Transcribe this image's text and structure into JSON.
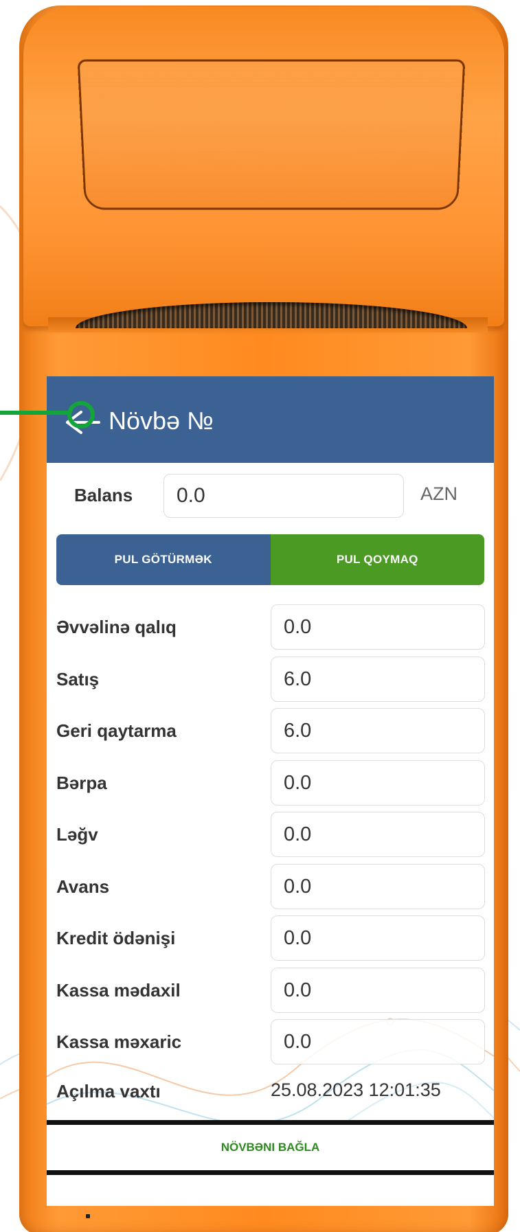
{
  "header": {
    "title": "Növbə №"
  },
  "balance": {
    "label": "Balans",
    "value": "0.0",
    "unit": "AZN"
  },
  "tabs": [
    {
      "label": "PUL GÖTÜRMƏK",
      "color": "#3c6193"
    },
    {
      "label": "PUL QOYMAQ",
      "color": "#4a9a24"
    }
  ],
  "fields": [
    {
      "label": "Əvvəlinə qalıq",
      "value": "0.0"
    },
    {
      "label": "Satış",
      "value": "6.0"
    },
    {
      "label": "Geri qaytarma",
      "value": "6.0"
    },
    {
      "label": "Bərpa",
      "value": "0.0"
    },
    {
      "label": "Ləğv",
      "value": "0.0"
    },
    {
      "label": "Avans",
      "value": "0.0"
    },
    {
      "label": "Kredit ödənişi",
      "value": "0.0"
    },
    {
      "label": "Kassa mədaxil",
      "value": "0.0"
    },
    {
      "label": "Kassa məxaric",
      "value": "0.0"
    }
  ],
  "opened": {
    "label": "Açılma vaxtı",
    "value": "25.08.2023 12:01:35"
  },
  "close_button": {
    "label": "NÖVBƏNI BAĞLA"
  },
  "colors": {
    "device_orange": "#ff8a20",
    "header_blue": "#3c6193",
    "accent_green": "#4a9a24",
    "pointer_green": "#13a53a"
  },
  "icons": {
    "back": "back-arrow-icon"
  }
}
